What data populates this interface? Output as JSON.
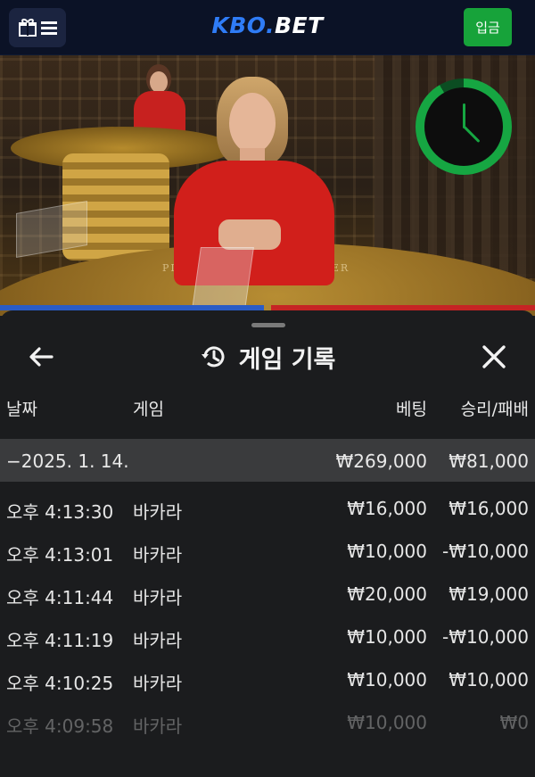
{
  "header": {
    "logo_part1": "KBO.",
    "logo_part2": "BET",
    "deposit_label": "입금",
    "icons": [
      "gift-icon",
      "menu-icon"
    ]
  },
  "video": {
    "table_text_player": "PLAYER",
    "table_text_banker": "BANKER",
    "timer_icon": "clock-icon",
    "colors": {
      "timer": "#16a642",
      "player": "#2a5cc6",
      "banker": "#c62424"
    }
  },
  "history": {
    "title": "게임 기록",
    "title_icon": "history-icon",
    "back_icon": "arrow-left-icon",
    "close_icon": "close-icon",
    "columns": {
      "date": "날짜",
      "game": "게임",
      "bet": "베팅",
      "result": "승리/패배"
    },
    "day": {
      "date": "−2025. 1. 14.",
      "bet": "₩269,000",
      "result": "₩81,000"
    },
    "rows": [
      {
        "time": "오후 4:13:30",
        "game": "바카라",
        "bet": "₩16,000",
        "result": "₩16,000"
      },
      {
        "time": "오후 4:13:01",
        "game": "바카라",
        "bet": "₩10,000",
        "result": "-₩10,000"
      },
      {
        "time": "오후 4:11:44",
        "game": "바카라",
        "bet": "₩20,000",
        "result": "₩19,000"
      },
      {
        "time": "오후 4:11:19",
        "game": "바카라",
        "bet": "₩10,000",
        "result": "-₩10,000"
      },
      {
        "time": "오후 4:10:25",
        "game": "바카라",
        "bet": "₩10,000",
        "result": "₩10,000"
      },
      {
        "time": "오후 4:09:58",
        "game": "바카라",
        "bet": "₩10,000",
        "result": "₩0"
      }
    ]
  }
}
